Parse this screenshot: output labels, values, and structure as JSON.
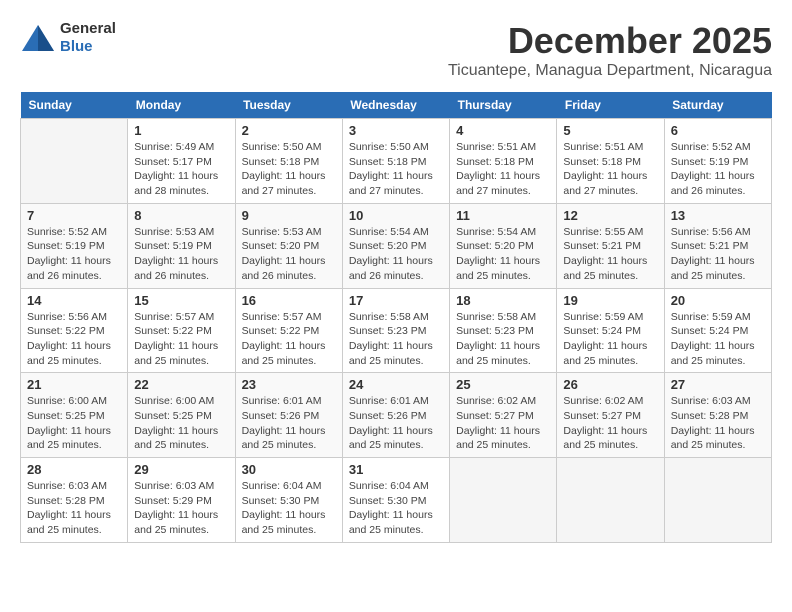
{
  "logo": {
    "general": "General",
    "blue": "Blue"
  },
  "header": {
    "month": "December 2025",
    "location": "Ticuantepe, Managua Department, Nicaragua"
  },
  "weekdays": [
    "Sunday",
    "Monday",
    "Tuesday",
    "Wednesday",
    "Thursday",
    "Friday",
    "Saturday"
  ],
  "weeks": [
    [
      {
        "day": "",
        "empty": true
      },
      {
        "day": "1",
        "sunrise": "5:49 AM",
        "sunset": "5:17 PM",
        "daylight": "11 hours and 28 minutes."
      },
      {
        "day": "2",
        "sunrise": "5:50 AM",
        "sunset": "5:18 PM",
        "daylight": "11 hours and 27 minutes."
      },
      {
        "day": "3",
        "sunrise": "5:50 AM",
        "sunset": "5:18 PM",
        "daylight": "11 hours and 27 minutes."
      },
      {
        "day": "4",
        "sunrise": "5:51 AM",
        "sunset": "5:18 PM",
        "daylight": "11 hours and 27 minutes."
      },
      {
        "day": "5",
        "sunrise": "5:51 AM",
        "sunset": "5:18 PM",
        "daylight": "11 hours and 27 minutes."
      },
      {
        "day": "6",
        "sunrise": "5:52 AM",
        "sunset": "5:19 PM",
        "daylight": "11 hours and 26 minutes."
      }
    ],
    [
      {
        "day": "7",
        "sunrise": "5:52 AM",
        "sunset": "5:19 PM",
        "daylight": "11 hours and 26 minutes."
      },
      {
        "day": "8",
        "sunrise": "5:53 AM",
        "sunset": "5:19 PM",
        "daylight": "11 hours and 26 minutes."
      },
      {
        "day": "9",
        "sunrise": "5:53 AM",
        "sunset": "5:20 PM",
        "daylight": "11 hours and 26 minutes."
      },
      {
        "day": "10",
        "sunrise": "5:54 AM",
        "sunset": "5:20 PM",
        "daylight": "11 hours and 26 minutes."
      },
      {
        "day": "11",
        "sunrise": "5:54 AM",
        "sunset": "5:20 PM",
        "daylight": "11 hours and 25 minutes."
      },
      {
        "day": "12",
        "sunrise": "5:55 AM",
        "sunset": "5:21 PM",
        "daylight": "11 hours and 25 minutes."
      },
      {
        "day": "13",
        "sunrise": "5:56 AM",
        "sunset": "5:21 PM",
        "daylight": "11 hours and 25 minutes."
      }
    ],
    [
      {
        "day": "14",
        "sunrise": "5:56 AM",
        "sunset": "5:22 PM",
        "daylight": "11 hours and 25 minutes."
      },
      {
        "day": "15",
        "sunrise": "5:57 AM",
        "sunset": "5:22 PM",
        "daylight": "11 hours and 25 minutes."
      },
      {
        "day": "16",
        "sunrise": "5:57 AM",
        "sunset": "5:22 PM",
        "daylight": "11 hours and 25 minutes."
      },
      {
        "day": "17",
        "sunrise": "5:58 AM",
        "sunset": "5:23 PM",
        "daylight": "11 hours and 25 minutes."
      },
      {
        "day": "18",
        "sunrise": "5:58 AM",
        "sunset": "5:23 PM",
        "daylight": "11 hours and 25 minutes."
      },
      {
        "day": "19",
        "sunrise": "5:59 AM",
        "sunset": "5:24 PM",
        "daylight": "11 hours and 25 minutes."
      },
      {
        "day": "20",
        "sunrise": "5:59 AM",
        "sunset": "5:24 PM",
        "daylight": "11 hours and 25 minutes."
      }
    ],
    [
      {
        "day": "21",
        "sunrise": "6:00 AM",
        "sunset": "5:25 PM",
        "daylight": "11 hours and 25 minutes."
      },
      {
        "day": "22",
        "sunrise": "6:00 AM",
        "sunset": "5:25 PM",
        "daylight": "11 hours and 25 minutes."
      },
      {
        "day": "23",
        "sunrise": "6:01 AM",
        "sunset": "5:26 PM",
        "daylight": "11 hours and 25 minutes."
      },
      {
        "day": "24",
        "sunrise": "6:01 AM",
        "sunset": "5:26 PM",
        "daylight": "11 hours and 25 minutes."
      },
      {
        "day": "25",
        "sunrise": "6:02 AM",
        "sunset": "5:27 PM",
        "daylight": "11 hours and 25 minutes."
      },
      {
        "day": "26",
        "sunrise": "6:02 AM",
        "sunset": "5:27 PM",
        "daylight": "11 hours and 25 minutes."
      },
      {
        "day": "27",
        "sunrise": "6:03 AM",
        "sunset": "5:28 PM",
        "daylight": "11 hours and 25 minutes."
      }
    ],
    [
      {
        "day": "28",
        "sunrise": "6:03 AM",
        "sunset": "5:28 PM",
        "daylight": "11 hours and 25 minutes."
      },
      {
        "day": "29",
        "sunrise": "6:03 AM",
        "sunset": "5:29 PM",
        "daylight": "11 hours and 25 minutes."
      },
      {
        "day": "30",
        "sunrise": "6:04 AM",
        "sunset": "5:30 PM",
        "daylight": "11 hours and 25 minutes."
      },
      {
        "day": "31",
        "sunrise": "6:04 AM",
        "sunset": "5:30 PM",
        "daylight": "11 hours and 25 minutes."
      },
      {
        "day": "",
        "empty": true
      },
      {
        "day": "",
        "empty": true
      },
      {
        "day": "",
        "empty": true
      }
    ]
  ]
}
